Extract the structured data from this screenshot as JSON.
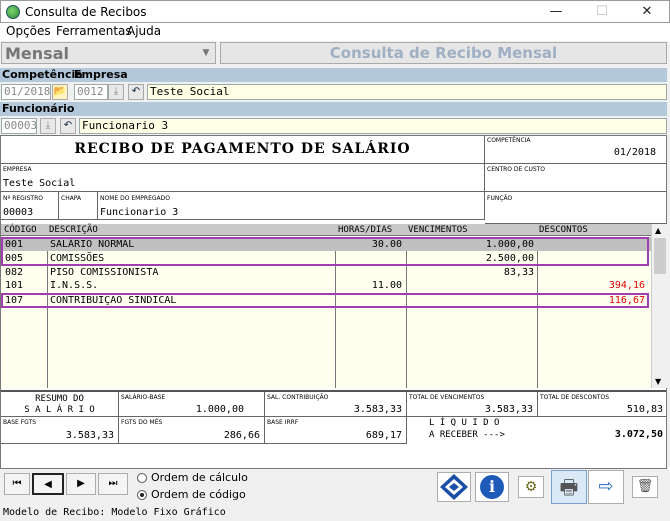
{
  "window": {
    "title": "Consulta de Recibos",
    "minimize": "—",
    "maximize": "☐",
    "close": "✕"
  },
  "menu": [
    "Opções",
    "Ferramentas",
    "Ajuda"
  ],
  "mode": {
    "selected": "Mensal",
    "header": "Consulta de Recibo Mensal"
  },
  "labels": {
    "competencia": "Competência",
    "empresa": "Empresa",
    "funcionario": "Funcionário"
  },
  "fields": {
    "competencia": "01/2018",
    "empresa_code": "0012",
    "empresa_name": "Teste Social",
    "funcionario_code": "00003",
    "funcionario_name": "Funcionario 3"
  },
  "receipt": {
    "title": "RECIBO DE PAGAMENTO DE SALÁRIO",
    "competencia_label": "COMPETÊNCIA",
    "competencia": "01/2018",
    "empresa_label": "EMPRESA",
    "empresa": "Teste Social",
    "centro_label": "CENTRO DE CUSTO",
    "registro_label": "Nº REGISTRO",
    "registro": "00003",
    "chapa_label": "CHAPA",
    "nome_label": "NOME DO EMPREGADO",
    "nome": "Funcionario 3",
    "funcao_label": "FUNÇÃO",
    "columns": [
      "CÓDIGO",
      "DESCRIÇÃO",
      "HORAS/DIAS",
      "VENCIMENTOS",
      "DESCONTOS"
    ],
    "rows": [
      {
        "code": "001",
        "desc": "SALÁRIO NORMAL",
        "horas": "30.00",
        "venc": "1.000,00",
        "desc_val": ""
      },
      {
        "code": "005",
        "desc": "COMISSÕES",
        "horas": "",
        "venc": "2.500,00",
        "desc_val": ""
      },
      {
        "code": "082",
        "desc": "PISO COMISSIONISTA",
        "horas": "",
        "venc": "83,33",
        "desc_val": ""
      },
      {
        "code": "101",
        "desc": "I.N.S.S.",
        "horas": "11.00",
        "venc": "",
        "desc_val": "394,16"
      },
      {
        "code": "107",
        "desc": "CONTRIBUIÇÃO SINDICAL",
        "horas": "",
        "venc": "",
        "desc_val": "116,67"
      }
    ],
    "resumo_1": "RESUMO DO",
    "resumo_2": "S A L Á R I O",
    "salario_base_label": "SALÁRIO-BASE",
    "salario_base": "1.000,00",
    "sal_contrib_label": "SAL. CONTRIBUIÇÃO",
    "sal_contrib": "3.583,33",
    "total_venc_label": "TOTAL DE VENCIMENTOS",
    "total_venc": "3.583,33",
    "total_desc_label": "TOTAL DE DESCONTOS",
    "total_desc": "510,83",
    "base_fgts_label": "BASE FGTS",
    "base_fgts": "3.583,33",
    "fgts_mes_label": "FGTS DO MÊS",
    "fgts_mes": "286,66",
    "base_irrf_label": "BASE IRRF",
    "base_irrf": "689,17",
    "liquido_1": "L Í Q U I D O",
    "liquido_2": "A RECEBER --->",
    "liquido": "3.072,50"
  },
  "order": {
    "calculo": "Ordem de cálculo",
    "codigo": "Ordem de código",
    "selected": "codigo"
  },
  "status": "Modelo de Recibo: Modelo Fixo Gráfico",
  "colors": {
    "highlight_border": "#a040b0",
    "red_value": "#e00000",
    "section_bar": "#b4c8dc",
    "field_yellow": "#ffffe6"
  }
}
